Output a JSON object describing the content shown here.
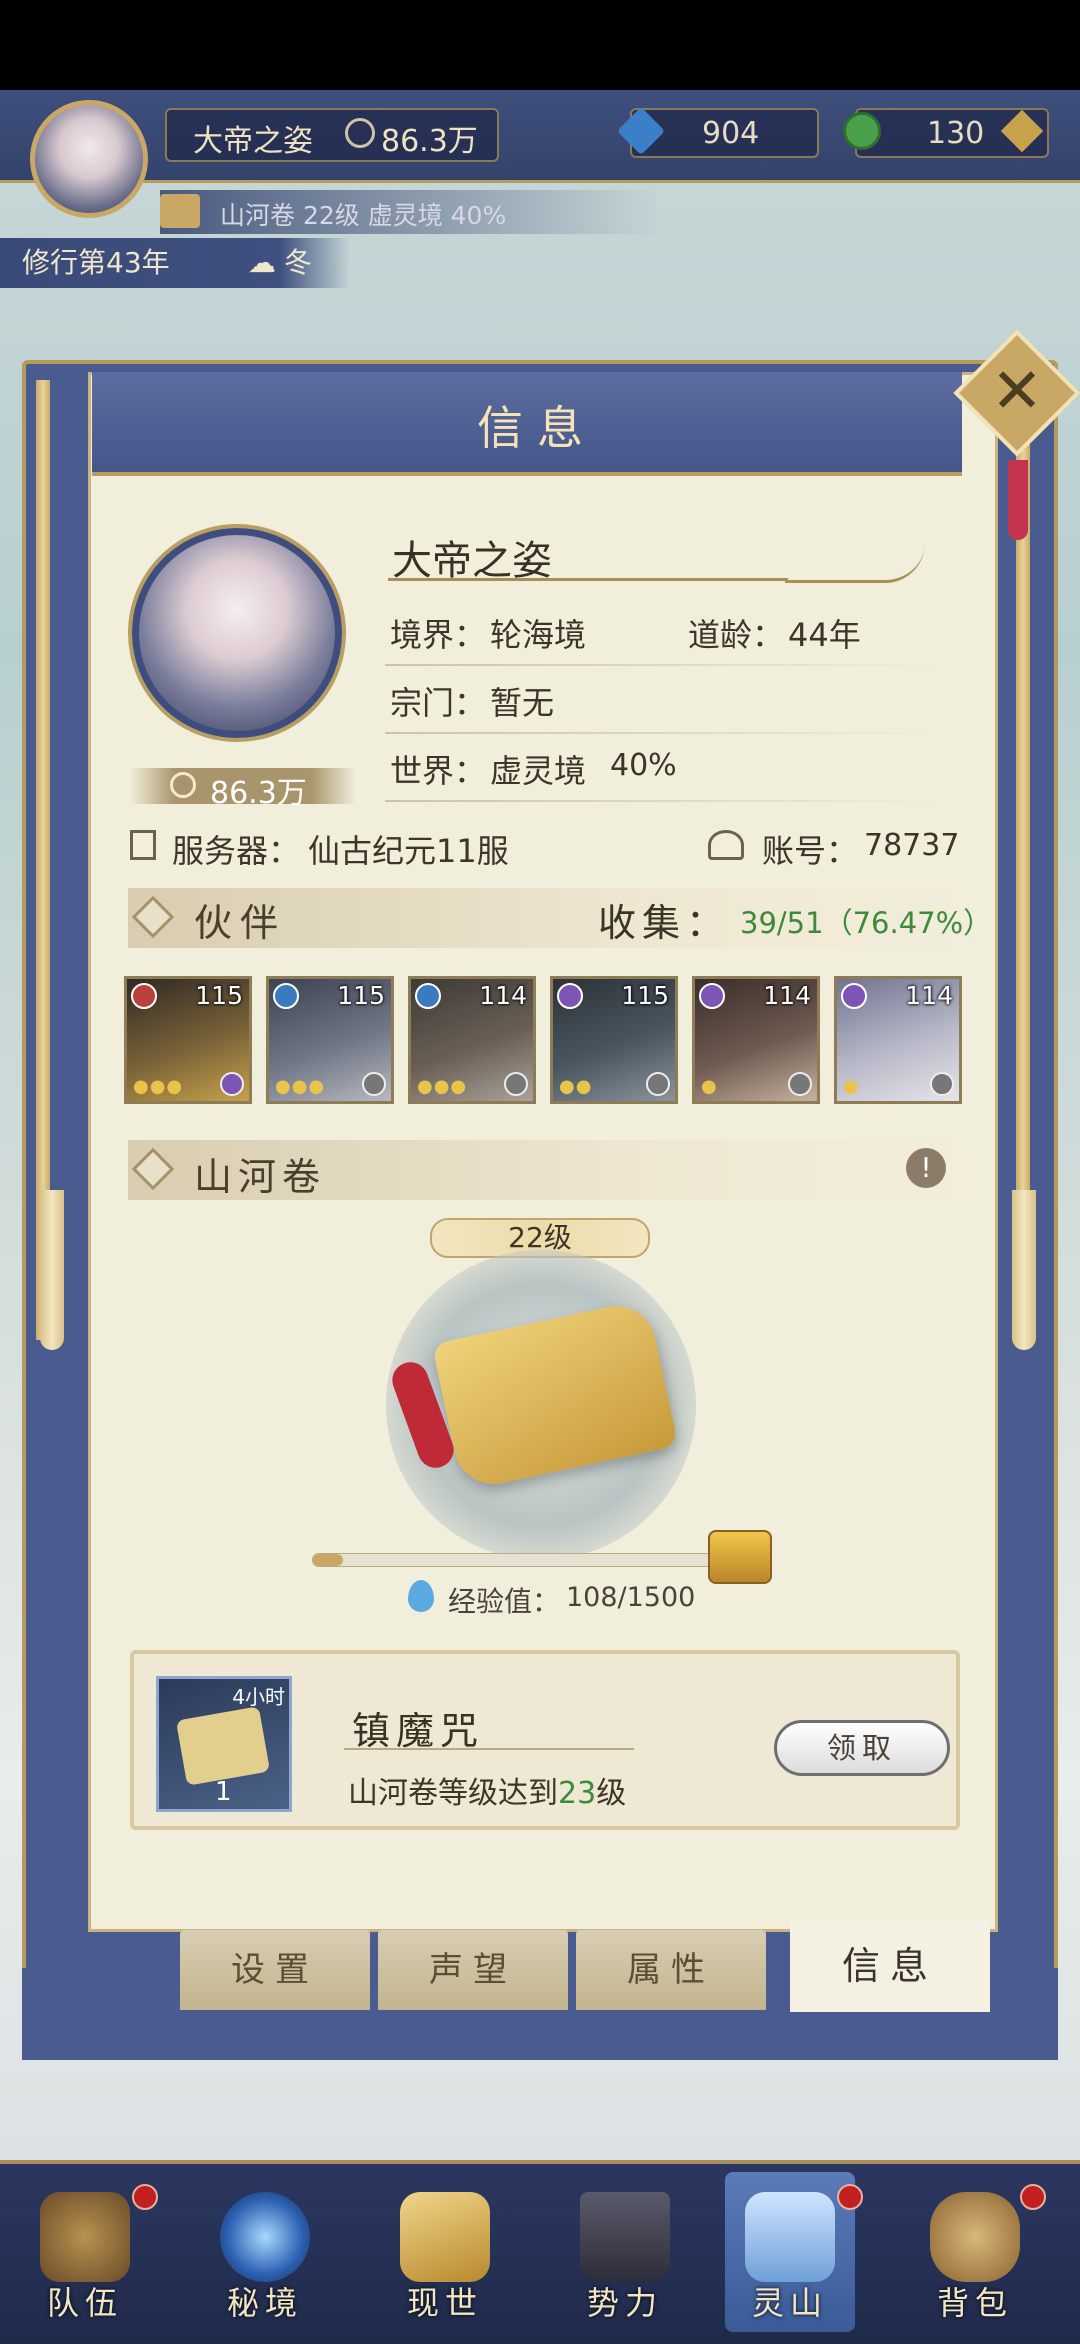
{
  "header": {
    "player_name": "大帝之姿",
    "power": "86.3万",
    "gems": "904",
    "jade": "130",
    "sub_info": "山河卷 22级 虚灵境 40%",
    "cultivation": "修行第43年",
    "season": "冬"
  },
  "panel": {
    "title": "信息",
    "name": "大帝之姿",
    "realm_label": "境界：",
    "realm_value": "轮海境",
    "age_label": "道龄：",
    "age_value": "44年",
    "sect_label": "宗门：",
    "sect_value": "暂无",
    "world_label": "世界：",
    "world_value": "虚灵境",
    "world_pct": "40%",
    "power": "86.3万",
    "server_label": "服务器：",
    "server_value": "仙古纪元11服",
    "account_label": "账号：",
    "account_value": "78737"
  },
  "partners": {
    "title": "伙伴",
    "collect_label": "收集：",
    "collect_value": "39/51（76.47%）",
    "items": [
      {
        "level": "115",
        "elem_color": "#b8423a",
        "stars": "●●●",
        "bg": "#6b5a3a"
      },
      {
        "level": "115",
        "elem_color": "#3a7bbf",
        "stars": "●●●",
        "bg": "#4a5566"
      },
      {
        "level": "114",
        "elem_color": "#3a7bbf",
        "stars": "●●●",
        "bg": "#5a5048"
      },
      {
        "level": "115",
        "elem_color": "#7d55b5",
        "stars": "●●",
        "bg": "#3f4a50"
      },
      {
        "level": "114",
        "elem_color": "#7d55b5",
        "stars": "●",
        "bg": "#5a4a44"
      },
      {
        "level": "114",
        "elem_color": "#7d55b5",
        "stars": "●",
        "bg": "#8a8ba0"
      }
    ]
  },
  "scroll": {
    "title": "山河卷",
    "level": "22级",
    "exp_label": "经验值：",
    "exp_value": "108/1500",
    "progress": 0.072
  },
  "reward": {
    "timer": "4小时",
    "count": "1",
    "name": "镇魔咒",
    "desc_prefix": "山河卷等级达到",
    "desc_level": "23",
    "desc_suffix": "级",
    "button": "领取"
  },
  "tabs": [
    "设置",
    "声望",
    "属性",
    "信息"
  ],
  "nav": [
    "队伍",
    "秘境",
    "现世",
    "势力",
    "灵山",
    "背包"
  ],
  "colors": {
    "accent_gold": "#b89e60",
    "panel_bg": "#f2eedc",
    "green_text": "#3c8a3a"
  }
}
